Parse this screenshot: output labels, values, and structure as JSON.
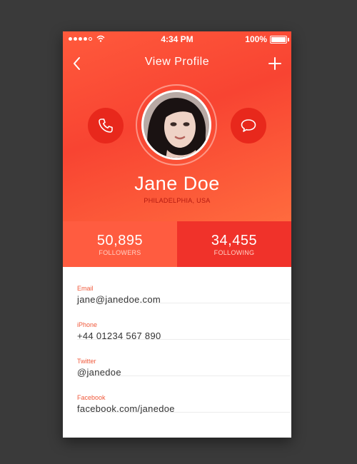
{
  "status_bar": {
    "time": "4:34 PM",
    "battery": "100%"
  },
  "navbar": {
    "title": "View Profile"
  },
  "profile": {
    "name": "Jane Doe",
    "location": "PHILADELPHIA, USA"
  },
  "stats": [
    {
      "value": "50,895",
      "label": "FOLLOWERS"
    },
    {
      "value": "34,455",
      "label": "FOLLOWING"
    }
  ],
  "contacts": [
    {
      "label": "Email",
      "value": "jane@janedoe.com"
    },
    {
      "label": "iPhone",
      "value": "+44 01234 567 890"
    },
    {
      "label": "Twitter",
      "value": "@janedoe"
    },
    {
      "label": "Facebook",
      "value": "facebook.com/janedoe"
    }
  ],
  "colors": {
    "accent": "#f84432",
    "button": "#e8281c",
    "stat_left": "#ff5c40",
    "stat_right": "#f0322a",
    "label": "#f05a3c"
  },
  "icons": [
    "back-icon",
    "plus-icon",
    "phone-icon",
    "chat-bubble-icon",
    "wifi-icon",
    "battery-icon"
  ]
}
